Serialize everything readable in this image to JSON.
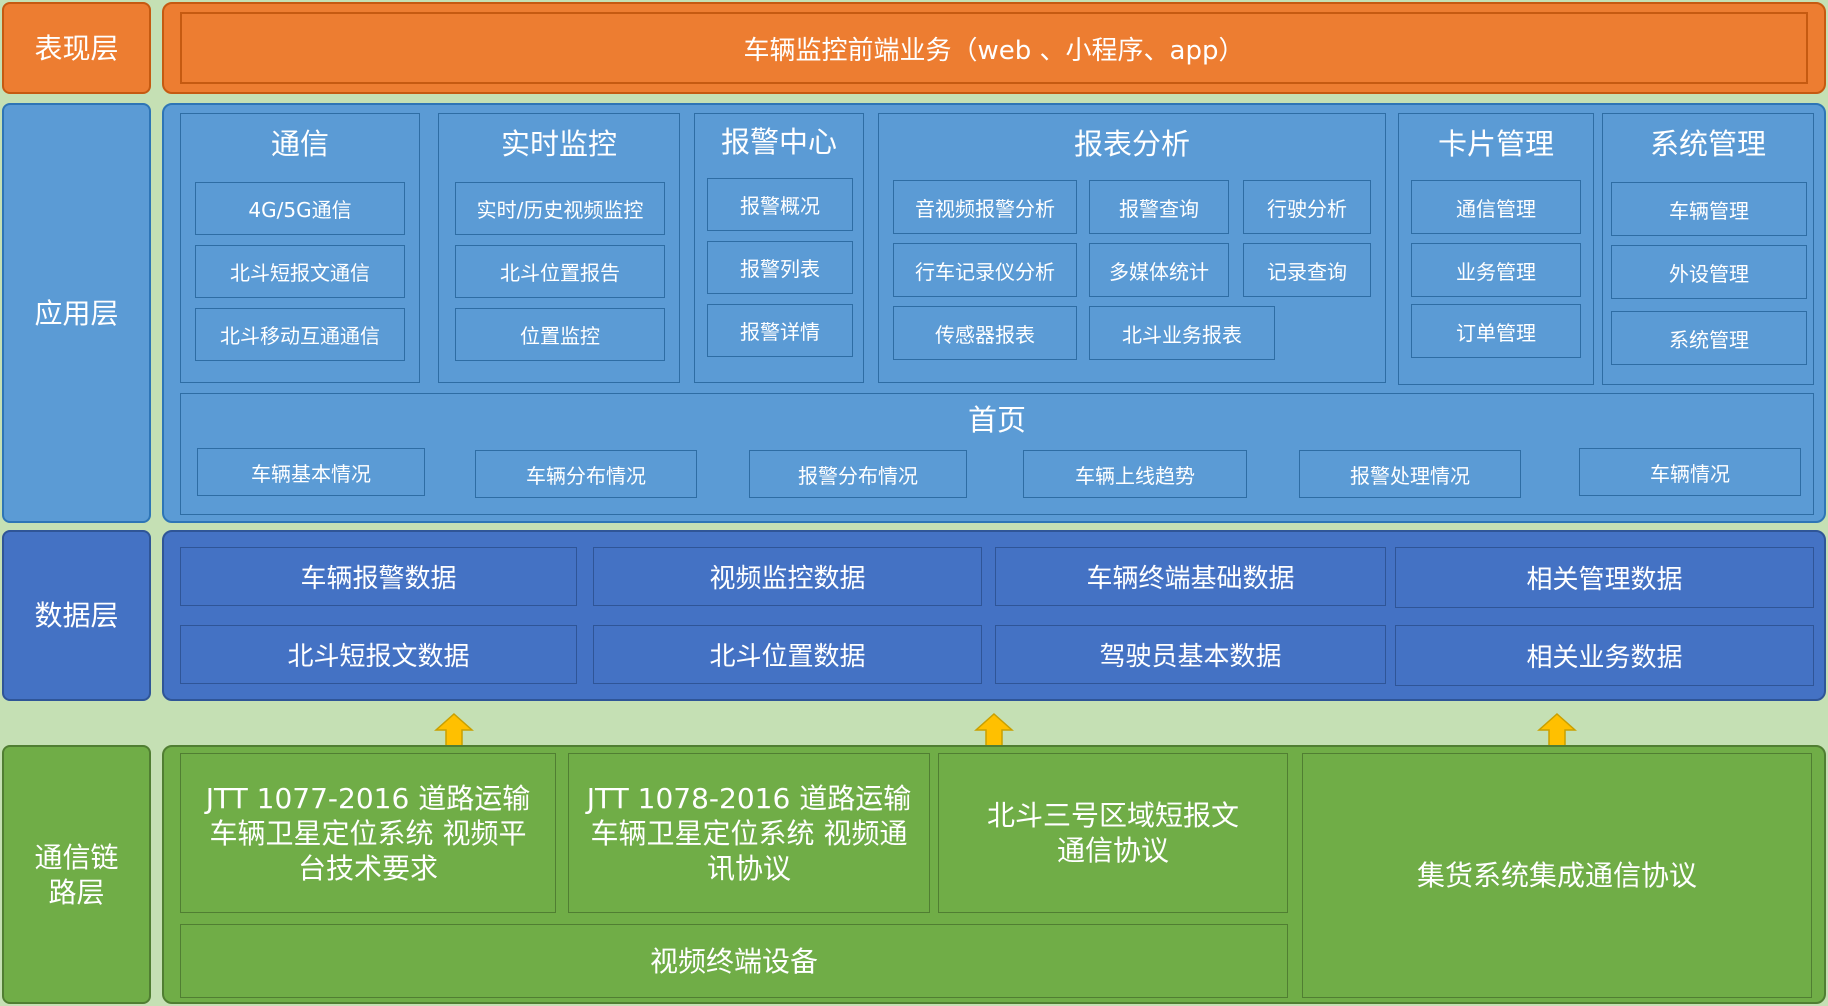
{
  "layers": {
    "presentation": "表现层",
    "application": "应用层",
    "data": "数据层",
    "link_line1": "通信链",
    "link_line2": "路层"
  },
  "presentation": {
    "banner": "车辆监控前端业务（web 、小程序、app）"
  },
  "application": {
    "groups": [
      {
        "title": "通信",
        "items": [
          "4G/5G通信",
          "北斗短报文通信",
          "北斗移动互通通信"
        ]
      },
      {
        "title": "实时监控",
        "items": [
          "实时/历史视频监控",
          "北斗位置报告",
          "位置监控"
        ]
      },
      {
        "title": "报警中心",
        "items": [
          "报警概况",
          "报警列表",
          "报警详情"
        ]
      },
      {
        "title": "报表分析",
        "items": [
          "音视频报警分析",
          "报警查询",
          "行驶分析",
          "行车记录仪分析",
          "多媒体统计",
          "记录查询",
          "传感器报表",
          "北斗业务报表"
        ]
      },
      {
        "title": "卡片管理",
        "items": [
          "通信管理",
          "业务管理",
          "订单管理"
        ]
      },
      {
        "title": "系统管理",
        "items": [
          "车辆管理",
          "外设管理",
          "系统管理"
        ]
      }
    ],
    "home": {
      "title": "首页",
      "items": [
        "车辆基本情况",
        "车辆分布情况",
        "报警分布情况",
        "车辆上线趋势",
        "报警处理情况",
        "车辆情况"
      ]
    }
  },
  "data": {
    "items": [
      "车辆报警数据",
      "视频监控数据",
      "车辆终端基础数据",
      "相关管理数据",
      "北斗短报文数据",
      "北斗位置数据",
      "驾驶员基本数据",
      "相关业务数据"
    ]
  },
  "link": {
    "items": [
      "JTT 1077-2016 道路运输车辆卫星定位系统 视频平台技术要求",
      "JTT 1078-2016 道路运输车辆卫星定位系统 视频通讯协议",
      "北斗三号区域短报文通信协议",
      "集货系统集成通信协议"
    ],
    "device": "视频终端设备"
  },
  "colors": {
    "orange": "#ed7d31",
    "light_blue": "#5b9bd5",
    "dark_blue": "#4472c4",
    "green": "#70ad47",
    "arrow": "#ffc000",
    "background": "#c5e0b4"
  }
}
